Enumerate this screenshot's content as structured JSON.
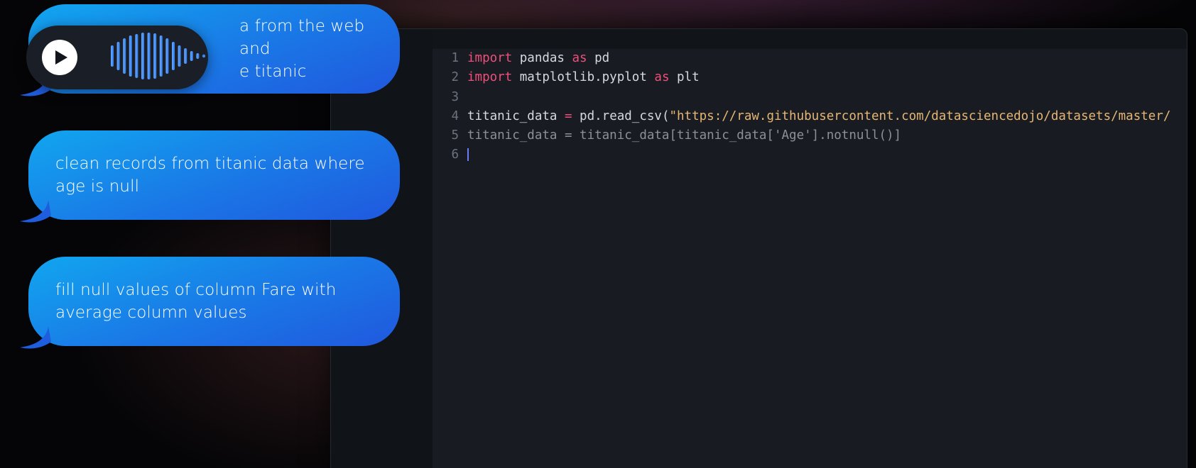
{
  "chat": {
    "messages": [
      {
        "line1": "… data from the web and",
        "line2": "… the titanic",
        "visible_line1": "a from the web and",
        "visible_line2": "e titanic"
      },
      {
        "line1": "clean records from titanic data where",
        "line2": "age is null"
      },
      {
        "line1": "fill null values of column Fare with",
        "line2": "average column values"
      }
    ],
    "audio": {
      "icon": "play-icon",
      "waveform_icon": "waveform-icon"
    }
  },
  "editor": {
    "lines": [
      {
        "num": "1",
        "kw1": "import",
        "t1": " pandas ",
        "kw2": "as",
        "t2": " pd"
      },
      {
        "num": "2",
        "kw1": "import",
        "t1": " matplotlib.pyplot ",
        "kw2": "as",
        "t2": " plt"
      },
      {
        "num": "3"
      },
      {
        "num": "4",
        "t1": "titanic_data ",
        "op": "=",
        "t2": " pd.read_csv(",
        "str": "\"https://raw.githubusercontent.com/datasciencedojo/datasets/master/"
      },
      {
        "num": "5",
        "dim": "titanic_data = titanic_data[titanic_data['Age'].notnull()]"
      },
      {
        "num": "6"
      }
    ]
  },
  "colors": {
    "bubble_top": "#11a6ef",
    "bubble_bottom": "#2058de",
    "keyword": "#ef4f7b",
    "string": "#e6b673",
    "cursor": "#6b7cf2"
  }
}
